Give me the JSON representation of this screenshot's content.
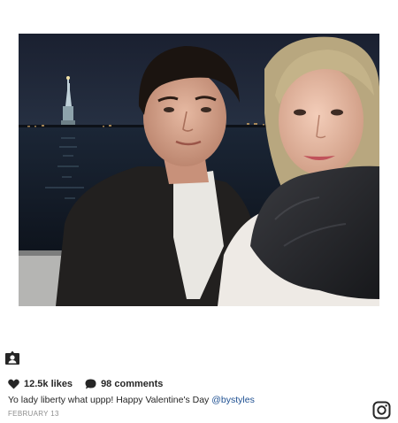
{
  "post": {
    "likes": "12.5k likes",
    "comments": "98 comments",
    "caption_text": "Yo lady liberty what uppp! Happy Valentine's Day ",
    "caption_mention": "@bystyles",
    "date": "FEBRUARY 13"
  },
  "icons": {
    "tag": "tagged-person-icon",
    "like": "heart-icon",
    "comment": "comment-bubble-icon",
    "brand": "instagram-logo-icon"
  },
  "colors": {
    "text": "#262626",
    "mention": "#1d4f91",
    "date": "#8e8e8e"
  }
}
